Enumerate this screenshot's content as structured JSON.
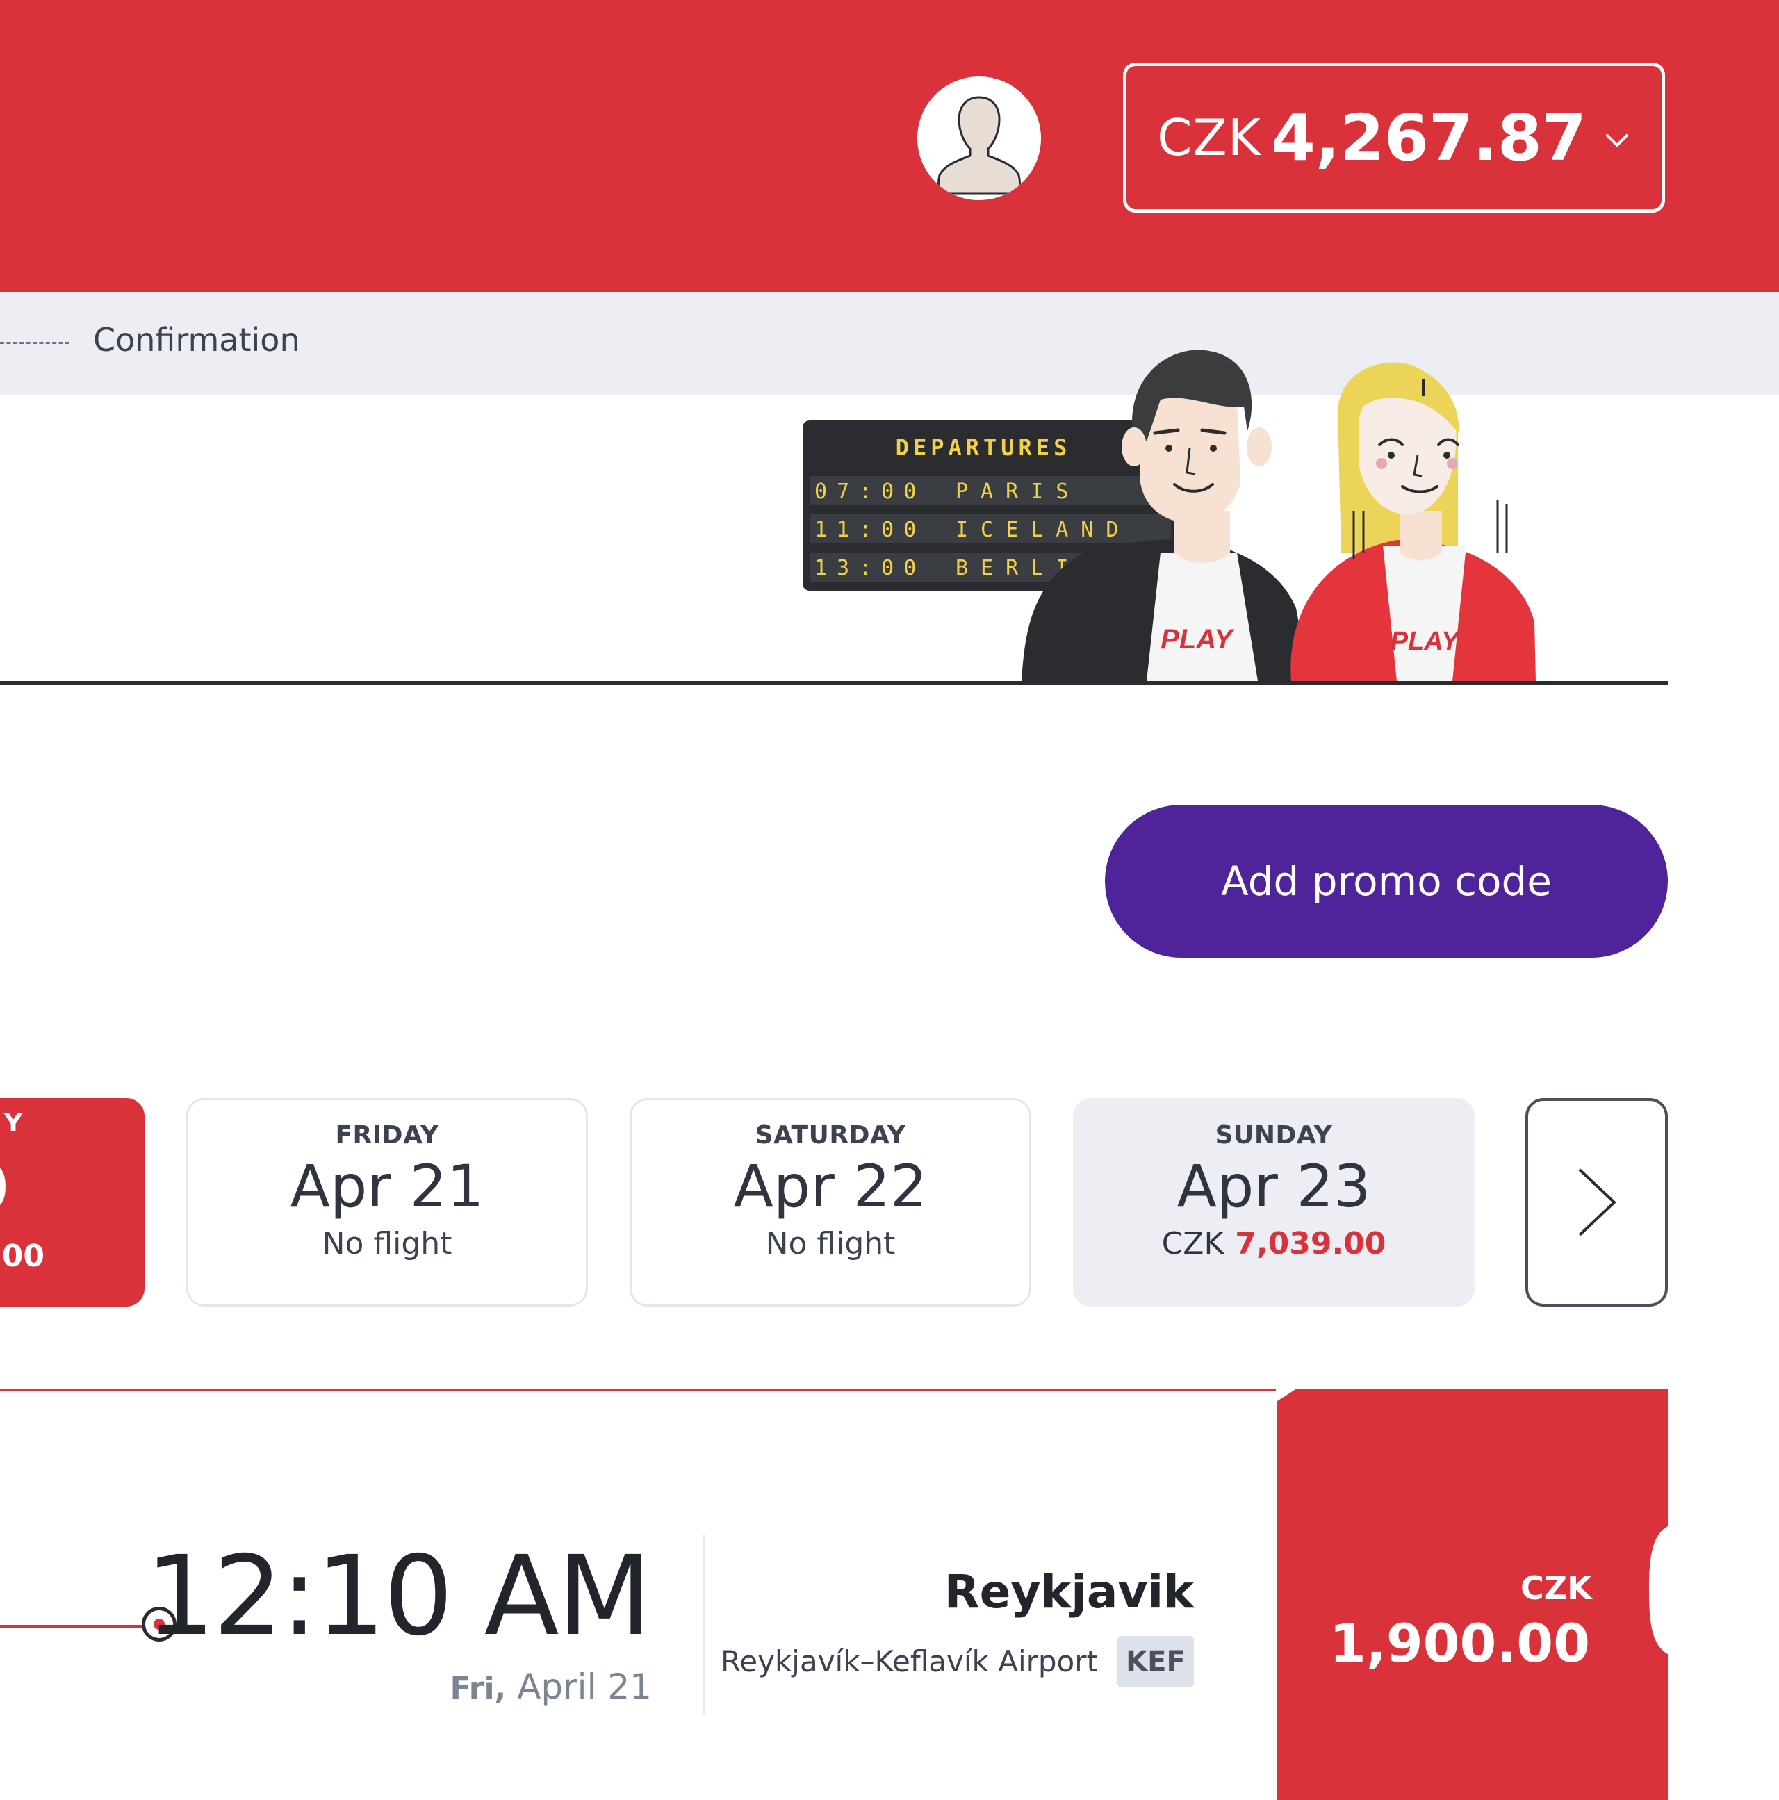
{
  "header": {
    "currency": {
      "code": "CZK",
      "amount": "4,267.87"
    }
  },
  "steps": {
    "current_visible": "Confirmation"
  },
  "illustration": {
    "board_title": "DEPARTURES",
    "board_rows": [
      {
        "time": "07:00",
        "city": "PARIS"
      },
      {
        "time": "11:00",
        "city": "ICELAND"
      },
      {
        "time": "13:00",
        "city": "BERLIN"
      }
    ],
    "shirt_logo": "PLAY"
  },
  "promo": {
    "button_label": "Add promo code"
  },
  "date_cards": {
    "partial": {
      "dow_fragment": "Y",
      "date_fragment": "0",
      "price_fragment": ".00"
    },
    "friday": {
      "dow": "FRIDAY",
      "date": "Apr 21",
      "status": "No flight"
    },
    "saturday": {
      "dow": "SATURDAY",
      "date": "Apr 22",
      "status": "No flight"
    },
    "sunday": {
      "dow": "SUNDAY",
      "date": "Apr 23",
      "currency": "CZK",
      "price": "7,039.00"
    }
  },
  "flight": {
    "arrival_time": "12:10 AM",
    "arrival_day": "Fri,",
    "arrival_date": "April 21",
    "arrival_city": "Reykjavik",
    "arrival_airport": "Reykjavík–Keflavík Airport",
    "arrival_code": "KEF",
    "fare_currency": "CZK",
    "fare_amount": "1,900.00"
  },
  "colors": {
    "brand_red": "#d9323b",
    "promo_purple": "#4f239a",
    "step_bar_bg": "#eceef3"
  }
}
